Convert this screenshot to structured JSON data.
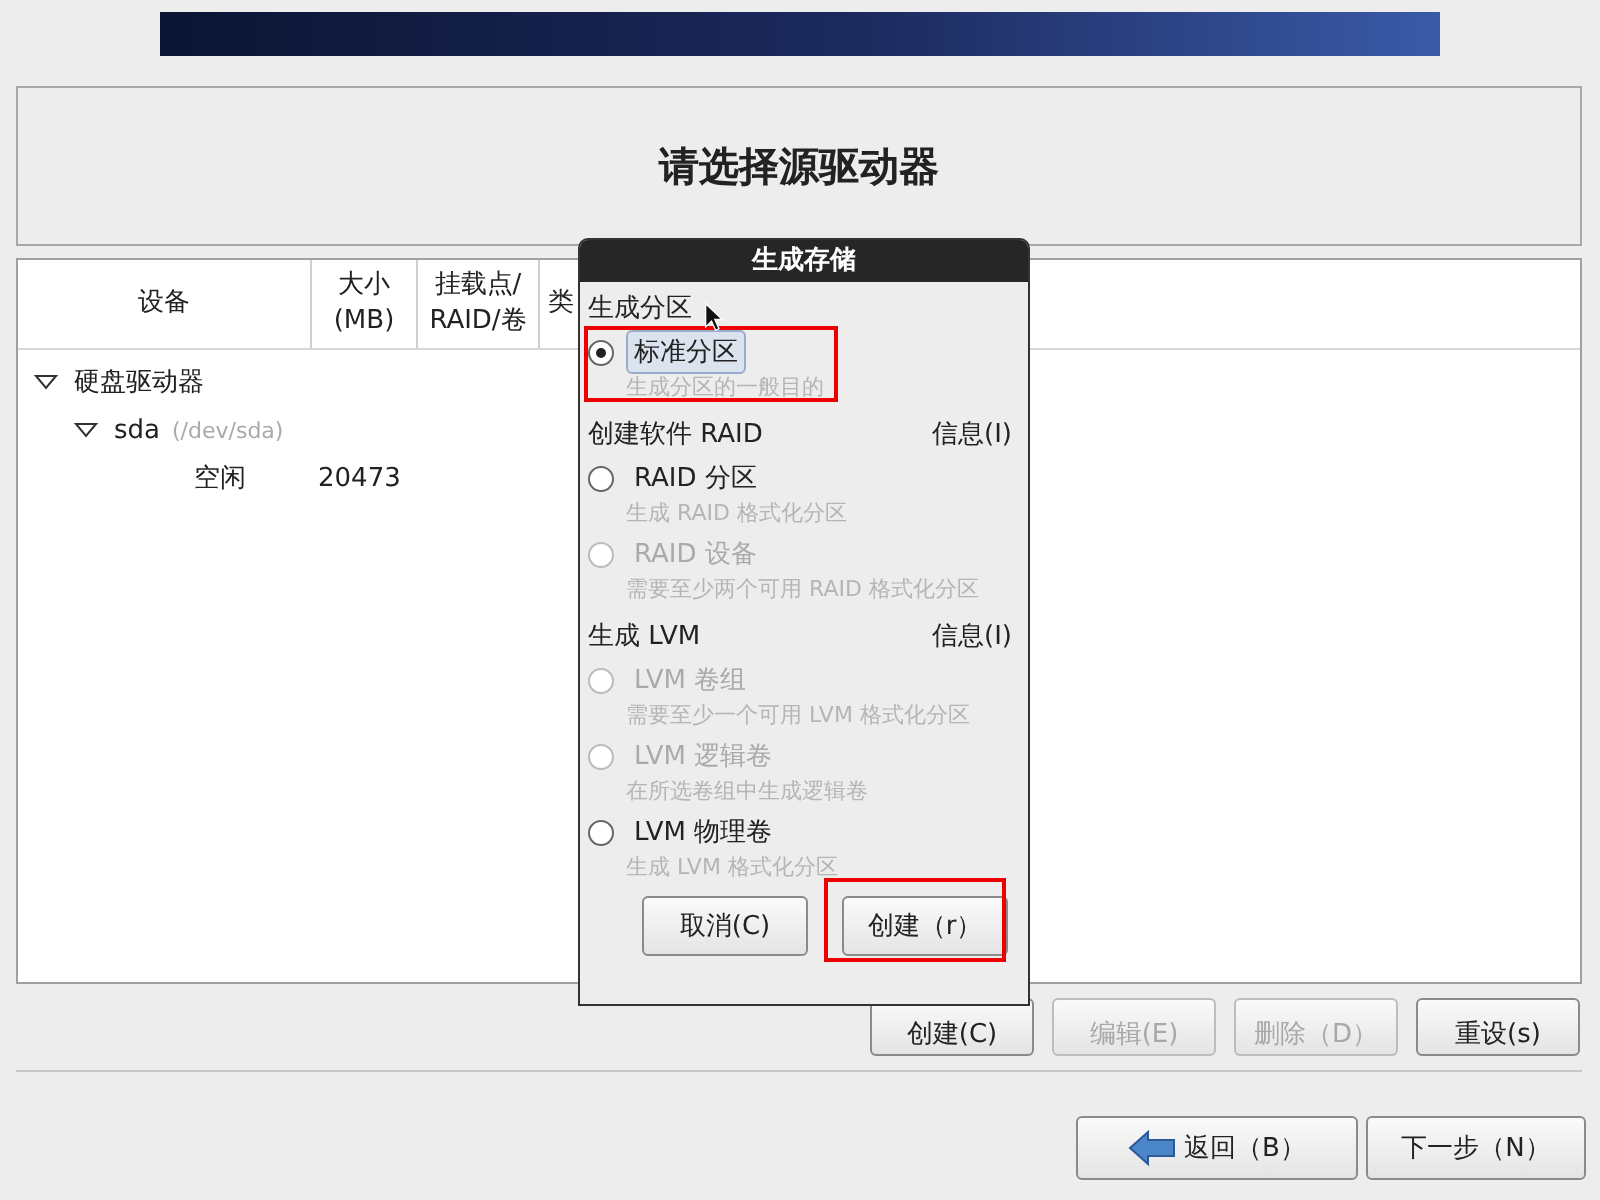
{
  "title": "请选择源驱动器",
  "table": {
    "columns": [
      {
        "lines": [
          "设备"
        ]
      },
      {
        "lines": [
          "大小",
          "(MB)"
        ]
      },
      {
        "lines": [
          "挂载点/",
          "RAID/卷"
        ]
      },
      {
        "lines": [
          "类"
        ]
      }
    ],
    "rows": [
      {
        "device": "硬盘驱动器",
        "expanded": true,
        "children": [
          {
            "device": "sda",
            "path": "(/dev/sda)",
            "expanded": true,
            "children": [
              {
                "device": "空闲",
                "size": "20473"
              }
            ]
          }
        ]
      }
    ]
  },
  "buttons": [
    {
      "label": "创建(C)",
      "disabled": false
    },
    {
      "label": "编辑(E)",
      "disabled": true
    },
    {
      "label": "删除（D）",
      "disabled": true
    },
    {
      "label": "重设(s)",
      "disabled": false
    }
  ],
  "nav": [
    {
      "label": "返回（B）",
      "kind": "back"
    },
    {
      "label": "下一步（N）",
      "kind": "next"
    }
  ],
  "dialog": {
    "title": "生成存储",
    "sections": [
      {
        "heading": "生成分区",
        "options": [
          {
            "label": "标准分区",
            "description": "生成分区的一般目的",
            "selected": true,
            "disabled": false,
            "annotated": true
          }
        ]
      },
      {
        "heading": "创建软件 RAID",
        "info": "信息(I)",
        "options": [
          {
            "label": "RAID 分区",
            "description": "生成 RAID 格式化分区",
            "selected": false,
            "disabled": false,
            "annotated": false
          },
          {
            "label": "RAID 设备",
            "description": "需要至少两个可用 RAID 格式化分区",
            "selected": false,
            "disabled": true,
            "annotated": false
          }
        ]
      },
      {
        "heading": "生成 LVM",
        "info": "信息(I)",
        "options": [
          {
            "label": "LVM 卷组",
            "description": "需要至少一个可用 LVM 格式化分区",
            "selected": false,
            "disabled": true,
            "annotated": false
          },
          {
            "label": "LVM 逻辑卷",
            "description": "在所选卷组中生成逻辑卷",
            "selected": false,
            "disabled": true,
            "annotated": false
          },
          {
            "label": "LVM 物理卷",
            "description": "生成 LVM 格式化分区",
            "selected": false,
            "disabled": false,
            "annotated": false
          }
        ]
      }
    ],
    "buttons": [
      {
        "label": "取消(C)",
        "annotated": false
      },
      {
        "label": "创建（r）",
        "annotated": true
      }
    ]
  }
}
